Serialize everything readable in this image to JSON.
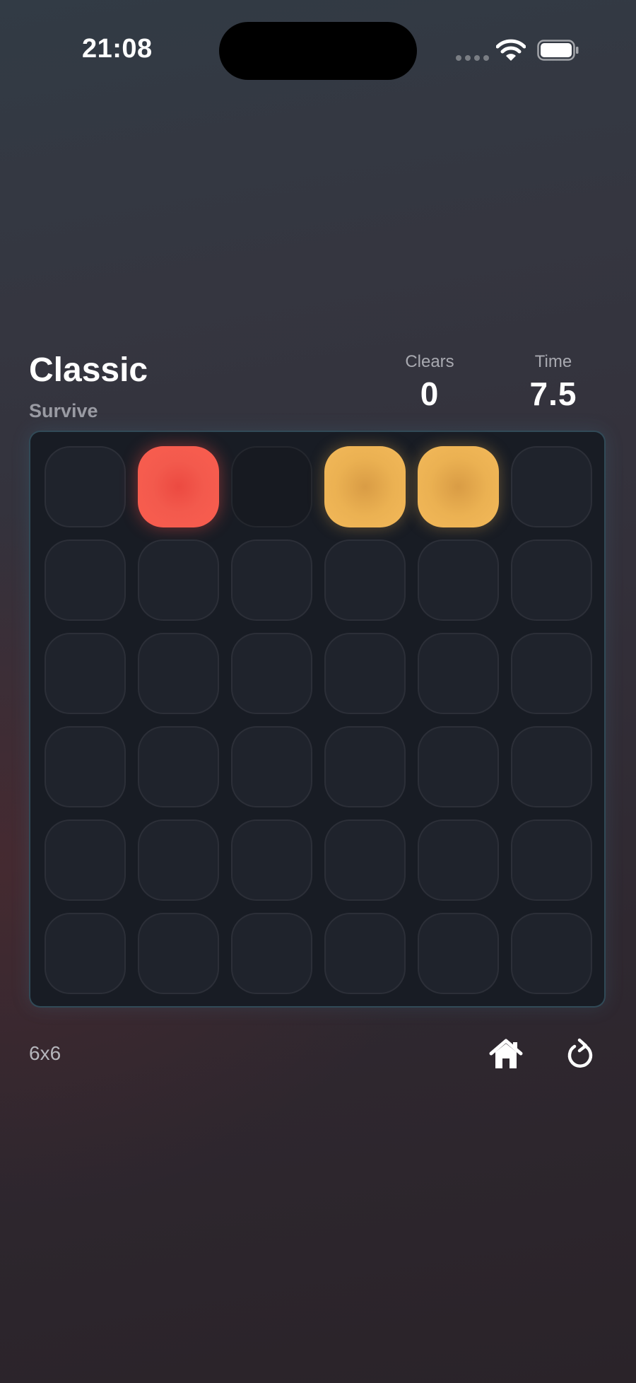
{
  "status_bar": {
    "time": "21:08"
  },
  "header": {
    "title": "Classic",
    "subtitle": "Survive",
    "stats": [
      {
        "label": "Clears",
        "value": "0"
      },
      {
        "label": "Time",
        "value": "7.5"
      }
    ]
  },
  "board": {
    "rows": 6,
    "cols": 6,
    "cells": [
      [
        "empty",
        "red",
        "dark",
        "yellow",
        "yellow",
        "empty"
      ],
      [
        "empty",
        "empty",
        "empty",
        "empty",
        "empty",
        "empty"
      ],
      [
        "empty",
        "empty",
        "empty",
        "empty",
        "empty",
        "empty"
      ],
      [
        "empty",
        "empty",
        "empty",
        "empty",
        "empty",
        "empty"
      ],
      [
        "empty",
        "empty",
        "empty",
        "empty",
        "empty",
        "empty"
      ],
      [
        "empty",
        "empty",
        "empty",
        "empty",
        "empty",
        "empty"
      ]
    ]
  },
  "footer": {
    "grid_size": "6x6",
    "home_icon": "home-icon",
    "restart_icon": "restart-icon"
  },
  "colors": {
    "red_tile": "#f55a4c",
    "yellow_tile": "#eeb455",
    "board_bg": "#181c24",
    "cell_bg": "#1f232c"
  }
}
